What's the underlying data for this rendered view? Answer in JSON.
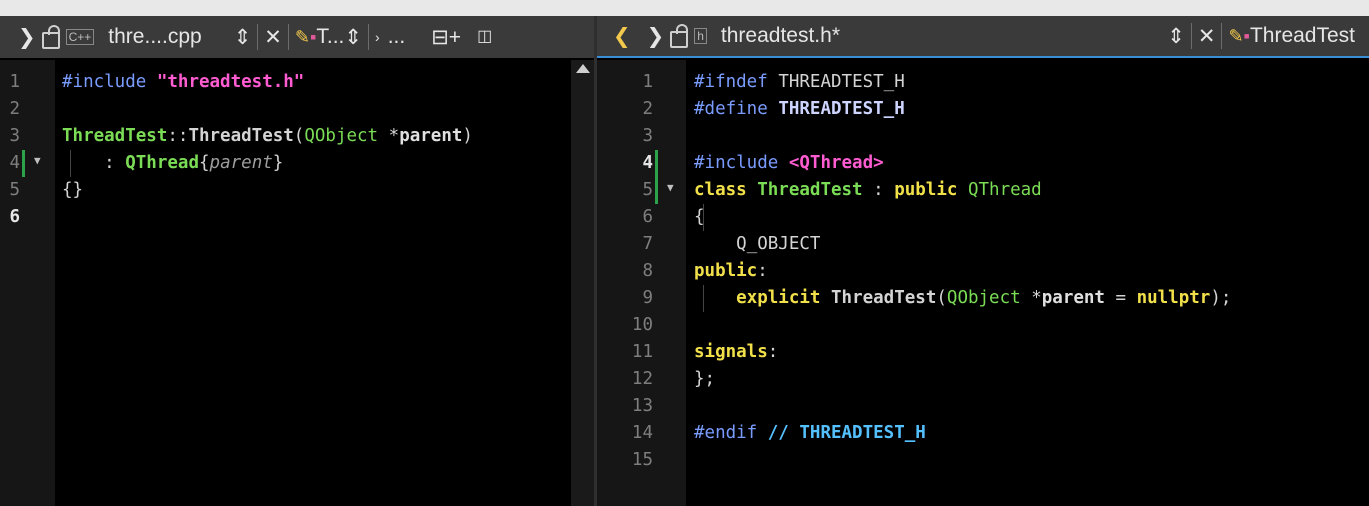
{
  "left": {
    "toolbar": {
      "nav_forward": "❯",
      "file_name": "thre....cpp",
      "updown": "⇕",
      "close": "✕",
      "class_name": "T...",
      "symbol_arrow": "›",
      "symbol_name": "...",
      "split": "⊟+",
      "close_split": "◫"
    },
    "lines": [
      {
        "n": "1"
      },
      {
        "n": "2"
      },
      {
        "n": "3"
      },
      {
        "n": "4"
      },
      {
        "n": "5"
      },
      {
        "n": "6"
      }
    ],
    "code": {
      "l1_dir": "#include",
      "l1_str": "\"threadtest.h\"",
      "l3_cls": "ThreadTest",
      "l3_sep": "::",
      "l3_fn": "ThreadTest",
      "l3_p1": "(",
      "l3_cls2": "QObject",
      "l3_ptr": " *",
      "l3_var": "parent",
      "l3_p2": ")",
      "l4_colon": ": ",
      "l4_cls": "QThread",
      "l4_b1": "{",
      "l4_it": "parent",
      "l4_b2": "}",
      "l5": "{}"
    }
  },
  "right": {
    "toolbar": {
      "nav_back": "❮",
      "nav_forward": "❯",
      "file_name": "threadtest.h*",
      "updown": "⇕",
      "close": "✕",
      "class_name": "ThreadTest"
    },
    "lines": [
      {
        "n": "1"
      },
      {
        "n": "2"
      },
      {
        "n": "3"
      },
      {
        "n": "4"
      },
      {
        "n": "5"
      },
      {
        "n": "6"
      },
      {
        "n": "7"
      },
      {
        "n": "8"
      },
      {
        "n": "9"
      },
      {
        "n": "10"
      },
      {
        "n": "11"
      },
      {
        "n": "12"
      },
      {
        "n": "13"
      },
      {
        "n": "14"
      },
      {
        "n": "15"
      }
    ],
    "code": {
      "l1_dir": "#ifndef",
      "l1_mac": "THREADTEST_H",
      "l2_dir": "#define",
      "l2_mac": "THREADTEST_H",
      "l4_dir": "#include",
      "l4_str": "<QThread>",
      "l5_kw": "class",
      "l5_cls": "ThreadTest",
      "l5_colon": " : ",
      "l5_kw2": "public",
      "l5_cls2": "QThread",
      "l6": "{",
      "l7": "Q_OBJECT",
      "l8_kw": "public",
      "l8_colon": ":",
      "l9_kw": "explicit",
      "l9_fn": "ThreadTest",
      "l9_p1": "(",
      "l9_cls": "QObject",
      "l9_ptr": " *",
      "l9_var": "parent",
      "l9_eq": " = ",
      "l9_null": "nullptr",
      "l9_end": ");",
      "l11_kw": "signals",
      "l11_colon": ":",
      "l12": "};",
      "l14_dir": "#endif",
      "l14_cm": "// THREADTEST_H"
    }
  }
}
